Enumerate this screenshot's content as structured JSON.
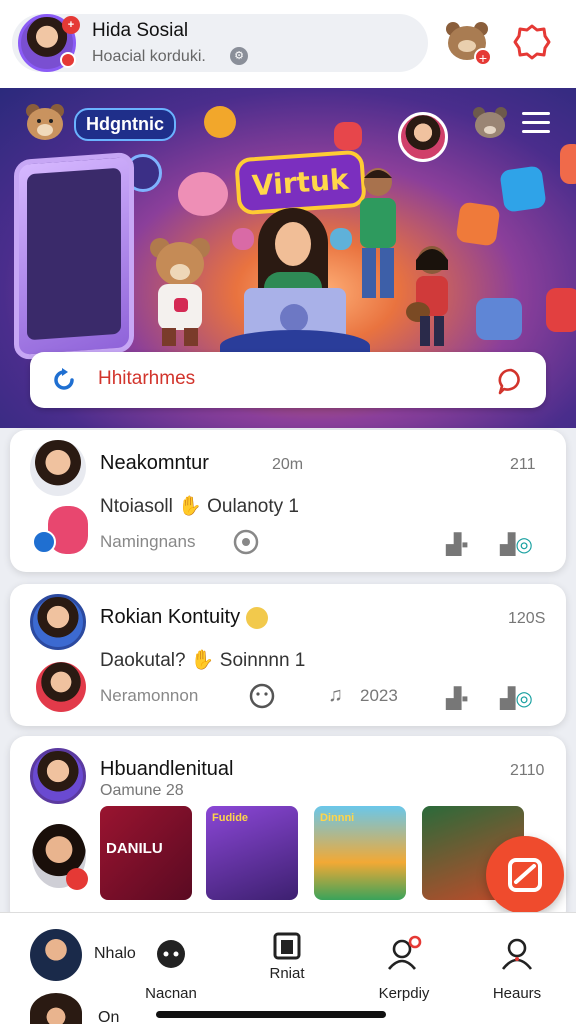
{
  "header": {
    "title": "Hida Sosial",
    "subtitle": "Hoacial korduki.",
    "badge": "+"
  },
  "hero": {
    "logo_label": "Hdgntnic",
    "title": "Virtuk",
    "search_placeholder": "Hhitarhmes",
    "colors": {
      "accent": "#ffd84a",
      "badge": "#7b2fbf"
    }
  },
  "feed": [
    {
      "name": "Neakomntur",
      "time": "20m",
      "count": "211",
      "message": "Ntoiasoll",
      "message2": "Oulanoty 1",
      "footer": "Namingnans"
    },
    {
      "name": "Rokian Kontuity",
      "count": "120S",
      "message": "Daokutal?",
      "message2": "Soinnnn 1",
      "footer": "Neramonnon",
      "year": "2023"
    },
    {
      "name": "Hbuandlenitual",
      "sub": "Oamune 28",
      "count": "2110"
    }
  ],
  "thumbnails": [
    {
      "label": "DANILU"
    },
    {
      "label": "Fudide"
    },
    {
      "label": "Dinnni"
    },
    {
      "label": ""
    }
  ],
  "bottom_nav": {
    "items": [
      {
        "label": "Nacnan",
        "icon": "chat-bubble-icon"
      },
      {
        "label": "Rniat",
        "icon": "square-icon"
      },
      {
        "label": "Kerpdiy",
        "icon": "user-notify-icon"
      },
      {
        "label": "Heaurs",
        "icon": "user-icon"
      }
    ],
    "side_label": "Nhalo",
    "side_label2": "On"
  }
}
